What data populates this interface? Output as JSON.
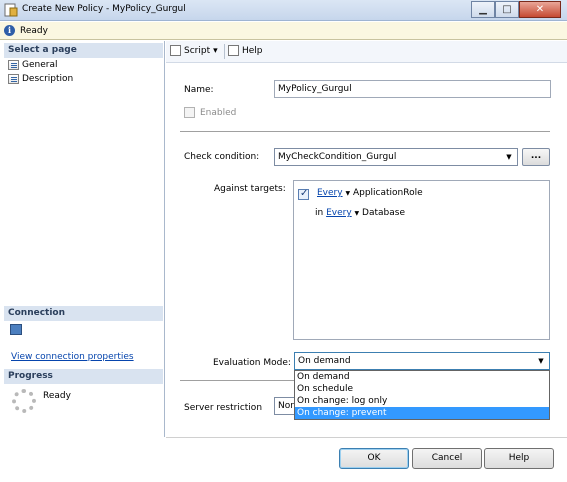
{
  "window": {
    "title": "Create New Policy - MyPolicy_Gurgul",
    "min_glyph": "▁",
    "max_glyph": "□",
    "close_glyph": "✕"
  },
  "status": {
    "icon": "info-icon",
    "glyph": "i",
    "text": "Ready"
  },
  "left": {
    "select_page_header": "Select a page",
    "pages": [
      {
        "label": "General",
        "icon": "page-icon"
      },
      {
        "label": "Description",
        "icon": "page-icon"
      }
    ],
    "connection_header": "Connection",
    "connection_link": "View connection properties",
    "progress_header": "Progress",
    "progress_text": "Ready"
  },
  "toolbar": {
    "script_label": "Script",
    "script_arrow": "▾",
    "help_label": "Help"
  },
  "form": {
    "name_label": "Name:",
    "name_value": "MyPolicy_Gurgul",
    "enabled_label": "Enabled",
    "check_condition_label": "Check condition:",
    "check_condition_value": "MyCheckCondition_Gurgul",
    "check_condition_arrow": "▼",
    "browse_label": "...",
    "against_targets_label": "Against targets:",
    "targets": {
      "row1": {
        "every": "Every",
        "arrow": "▼",
        "object": "ApplicationRole"
      },
      "row2": {
        "prefix": "in",
        "every": "Every",
        "arrow": "▼",
        "object": "Database"
      }
    },
    "evaluation_mode_label": "Evaluation Mode:",
    "evaluation_mode_value": "On demand",
    "evaluation_mode_arrow": "▼",
    "evaluation_options": [
      "On demand",
      "On schedule",
      "On change: log only",
      "On change: prevent"
    ],
    "evaluation_highlighted": "On change: prevent",
    "server_restriction_label": "Server restriction",
    "server_restriction_value": "Nor"
  },
  "buttons": {
    "ok": "OK",
    "cancel": "Cancel",
    "help": "Help"
  }
}
